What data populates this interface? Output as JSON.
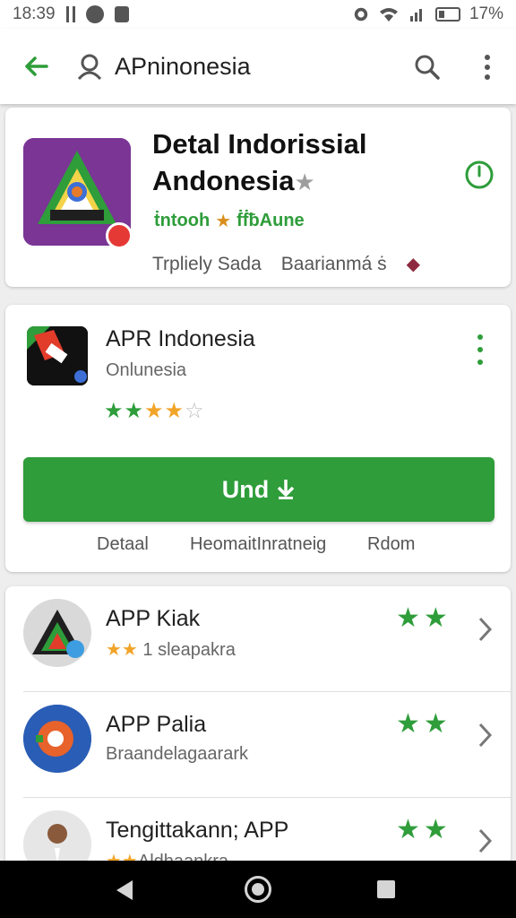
{
  "status_bar": {
    "time": "18:39",
    "battery_percent": "17%"
  },
  "app_bar": {
    "query": "APninonesia",
    "icons": [
      "back-arrow-icon",
      "search-icon",
      "search-icon",
      "more-vert-icon"
    ]
  },
  "hero": {
    "title_line1": "Detal Indorissial",
    "title_line2": "Andonesia",
    "rating_left": "ṫntooh",
    "rating_right": "ḟḟƀAune",
    "meta_left": "Trpliely Sada",
    "meta_right": "Baarianmá ṡ",
    "icons": [
      "app-logo-icon",
      "clock-icon",
      "star-icon",
      "heart-icon"
    ],
    "colors": {
      "accent": "#2e9d3a",
      "icon_bg": "#7a3595"
    }
  },
  "app_card": {
    "name": "APR Indonesia",
    "developer": "Onlunesia",
    "rating_stars": 4,
    "install_label": "Und",
    "tabs": [
      "Detaal",
      "HeomaitInratneig",
      "Rdom"
    ],
    "icons": [
      "app-icon",
      "more-vert-icon",
      "download-icon"
    ]
  },
  "related": [
    {
      "name": "APP Kiak",
      "subtitle": "1 sleapakra",
      "stars": "★★"
    },
    {
      "name": "APP Palia",
      "subtitle": "Braandelagaarark",
      "stars": "★★"
    },
    {
      "name": "Tengittakann; APP",
      "subtitle": "Aldhaankra",
      "stars": "★★"
    }
  ],
  "nav": {
    "icons": [
      "nav-back-icon",
      "nav-home-icon",
      "nav-recents-icon"
    ]
  }
}
